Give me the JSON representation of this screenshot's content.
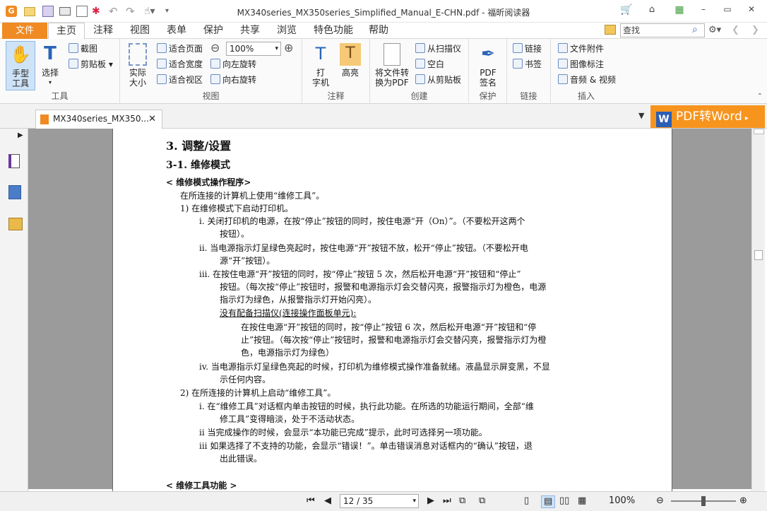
{
  "window": {
    "title": "MX340series_MX350series_Simplified_Manual_E-CHN.pdf - 福昕阅读器"
  },
  "ribbon_tabs": {
    "file": "文件",
    "home": "主页",
    "comment": "注释",
    "view": "视图",
    "form": "表单",
    "protect": "保护",
    "share": "共享",
    "browse": "浏览",
    "features": "特色功能",
    "help": "帮助"
  },
  "search": {
    "placeholder": "查找"
  },
  "ribbon": {
    "tools": {
      "label": "工具",
      "hand_l1": "手型",
      "hand_l2": "工具",
      "select": "选择",
      "snapshot": "截图",
      "clipboard": "剪贴板"
    },
    "view": {
      "label": "视图",
      "actual_l1": "实际",
      "actual_l2": "大小",
      "fit_page": "适合页面",
      "fit_width": "适合宽度",
      "fit_visible": "适合视区",
      "zoom": "100%",
      "rotate_left": "向左旋转",
      "rotate_right": "向右旋转"
    },
    "comment": {
      "label": "注释",
      "typewriter_l1": "打",
      "typewriter_l2": "字机",
      "highlight": "高亮"
    },
    "create": {
      "label": "创建",
      "convert_l1": "将文件转",
      "convert_l2": "换为PDF",
      "from_scanner": "从扫描仪",
      "blank": "空白",
      "from_clipboard": "从剪贴板"
    },
    "protect": {
      "label": "保护",
      "sign_l1": "PDF",
      "sign_l2": "签名"
    },
    "links": {
      "label": "链接",
      "link": "链接",
      "bookmark": "书签"
    },
    "insert": {
      "label": "插入",
      "attachment": "文件附件",
      "image": "图像标注",
      "media": "音频 & 视频"
    }
  },
  "doc_tab": {
    "name": "MX340series_MX350..."
  },
  "promo": {
    "label": "PDF转Word"
  },
  "document": {
    "heading": "3.   调整/设置",
    "subheading": "3-1.    维修模式",
    "section_title": "< 维修模式操作程序>",
    "intro": "在所连接的计算机上使用“维修工具”。",
    "step1": "1)    在维修模式下启动打印机。",
    "s1i_a": "i.      关闭打印机的电源，在按“停止”按钮的同时，按住电源“开（On）”。（不要松开这两个",
    "s1i_b": "按钮）。",
    "s1ii_a": "ii.     当电源指示灯呈绿色亮起时，按住电源“开”按钮不放，松开“停止”按钮。（不要松开电",
    "s1ii_b": "源“开”按钮）。",
    "s1iii_a": "iii.    在按住电源“开”按钮的同时，按“停止”按钮 5 次，然后松开电源“开”按钮和“停止”",
    "s1iii_b": "按钮。（每次按“停止”按钮时，报警和电源指示灯会交替闪亮，报警指示灯为橙色，电源",
    "s1iii_c": "指示灯为绿色，从报警指示灯开始闪亮）。",
    "noscanner": "没有配备扫描仪(连接操作面板单元):",
    "ns_a": "在按住电源“开”按钮的同时，按“停止”按钮 6 次，然后松开电源“开”按钮和“停",
    "ns_b": "止”按钮。（每次按“停止”按钮时，报警和电源指示灯会交替闪亮，报警指示灯为橙",
    "ns_c": "色，电源指示灯为绿色）",
    "s1iv_a": "iv.    当电源指示灯呈绿色亮起的时候，打印机为维修模式操作准备就绪。液晶显示屏变黑，不显",
    "s1iv_b": "示任何内容。",
    "step2": "2)    在所连接的计算机上启动“维修工具”。",
    "s2i_a": "i.      在“维修工具”对话框内单击按钮的时候，执行此功能。在所选的功能运行期间，全部“维",
    "s2i_b": "修工具”变得暗淡，处于不活动状态。",
    "s2ii": "ii      当完成操作的时候，会显示“本功能已完成”提示，此时可选择另一项功能。",
    "s2iii_a": "iii     如果选择了不支持的功能，会显示“错误！”。单击错误消息对话框内的“确认”按钮，退",
    "s2iii_b": "出此错误。",
    "tools_title": "< 维修工具功能 >"
  },
  "status": {
    "page": "12 / 35",
    "zoom": "100%"
  },
  "colors": {
    "accent": "#f08a22",
    "promo": "#f7941d",
    "canvas": "#9b9b9b"
  }
}
